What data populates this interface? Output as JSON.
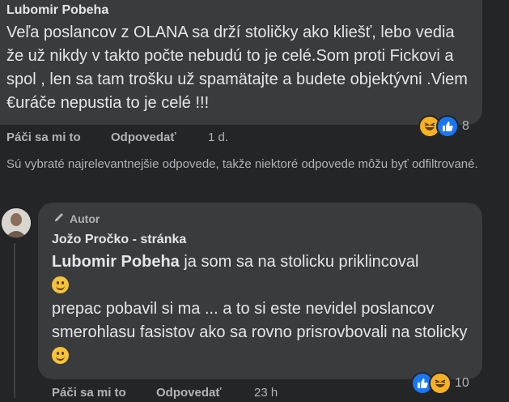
{
  "comment": {
    "author": "Lubomir Pobeha",
    "text": "Veľa poslancov z OLANA sa drží stoličky ako kliešť, lebo vedia že už nikdy v takto počte nebudú to je celé.Som proti Fickovi a spol , len sa tam trošku už spamätajte a budete objektývni .Viem €uráče nepustia to je celé !!!",
    "like_label": "Páči sa mi to",
    "reply_label": "Odpovedať",
    "time": "1 d.",
    "reactions": [
      "haha-icon",
      "like-icon"
    ],
    "reaction_count": "8"
  },
  "filter_note": "Sú vybraté najrelevantnejšie odpovede, takže niektoré odpovede môžu byť odfiltrované.",
  "reply": {
    "badge": "Autor",
    "author": "Jožo Pročko - stránka",
    "mention": "Lubomir Pobeha",
    "text_part1": "ja som sa na stolicku priklincoval",
    "text_part2": "prepac pobavil si ma ... a to si este nevidel poslancov smerohlasu fasistov ako sa rovno prisrovbovali na stolicky",
    "like_label": "Páči sa mi to",
    "reply_label": "Odpovedať",
    "time": "23 h",
    "reactions": [
      "like-icon",
      "haha-icon"
    ],
    "reaction_count": "10"
  },
  "colors": {
    "background": "#242526",
    "bubble": "#3a3b3c",
    "text": "#e4e6eb",
    "secondary": "#b0b3b8",
    "like": "#1877f2",
    "haha": "#f7b125"
  }
}
